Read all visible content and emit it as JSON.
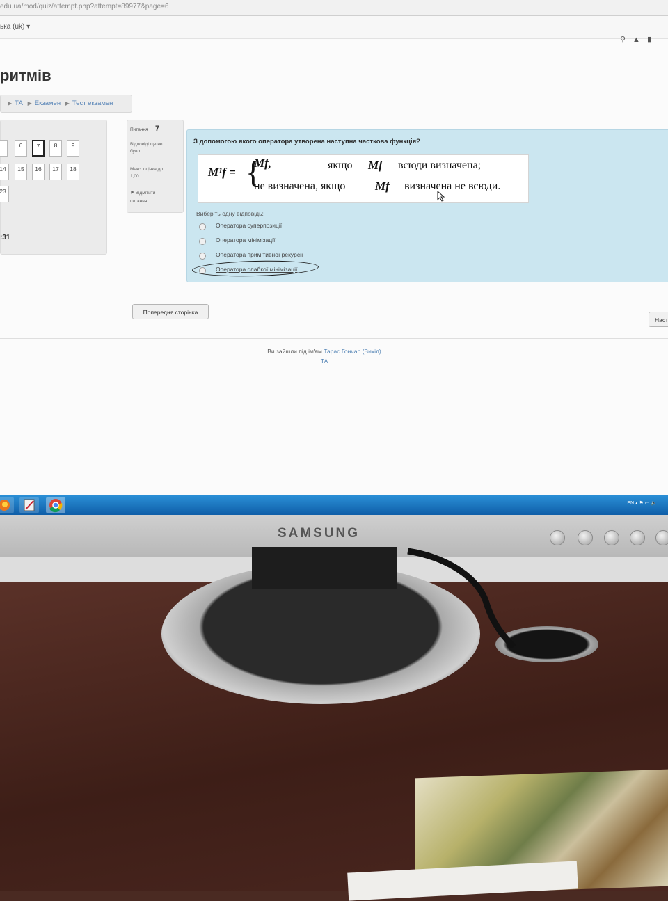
{
  "browser": {
    "url": "edu.ua/mod/quiz/attempt.php?attempt=89977&page=6",
    "language": "ька (uk) ▾"
  },
  "header": {
    "title": "ритмів",
    "breadcrumb": [
      "ТА",
      "Екзамен",
      "Тест екзамен"
    ]
  },
  "quiz_nav": {
    "row1": [
      "6",
      "7",
      "8",
      "9"
    ],
    "row2": [
      "14",
      "15",
      "16",
      "17",
      "18"
    ],
    "row3": [
      "23"
    ],
    "current": "7",
    "timer": ":31"
  },
  "question_info": {
    "label": "Питання",
    "number": "7",
    "status": [
      "Відповіді ще не",
      "було"
    ],
    "max_score": [
      "Макс. оцінка до",
      "1,00"
    ],
    "flag": [
      "Відмітити",
      "питання"
    ]
  },
  "question": {
    "text": "З допомогою якого оператора утворена наступна часткова функція?",
    "formula": {
      "lhs": "M¹f =",
      "case1_value": "Mf,",
      "case1_cond": "якщо",
      "case1_cond_var": "Mf",
      "case1_rest": "всюди   визначена;",
      "case2_value": "не визначена, якщо",
      "case2_cond_var": "Mf",
      "case2_rest": "визначена не всюди."
    },
    "choose_label": "Виберіть одну відповідь:",
    "options": [
      "Оператора суперпозиції",
      "Оператора мінімізації",
      "Оператора примітивної рекурсії",
      "Оператора слабкої мінімізації"
    ]
  },
  "navigation": {
    "prev": "Попередня сторінка",
    "next": "Насту"
  },
  "footer": {
    "logged_in_prefix": "Ви зайшли під ім'ям",
    "user": "Тарас Гончар",
    "logout": "(Вихід)",
    "course": "ТА"
  },
  "taskbar": {
    "tray": "EN  ▴  ⚑ ▭ 🔈"
  },
  "monitor": {
    "brand": "SAMSUNG"
  }
}
